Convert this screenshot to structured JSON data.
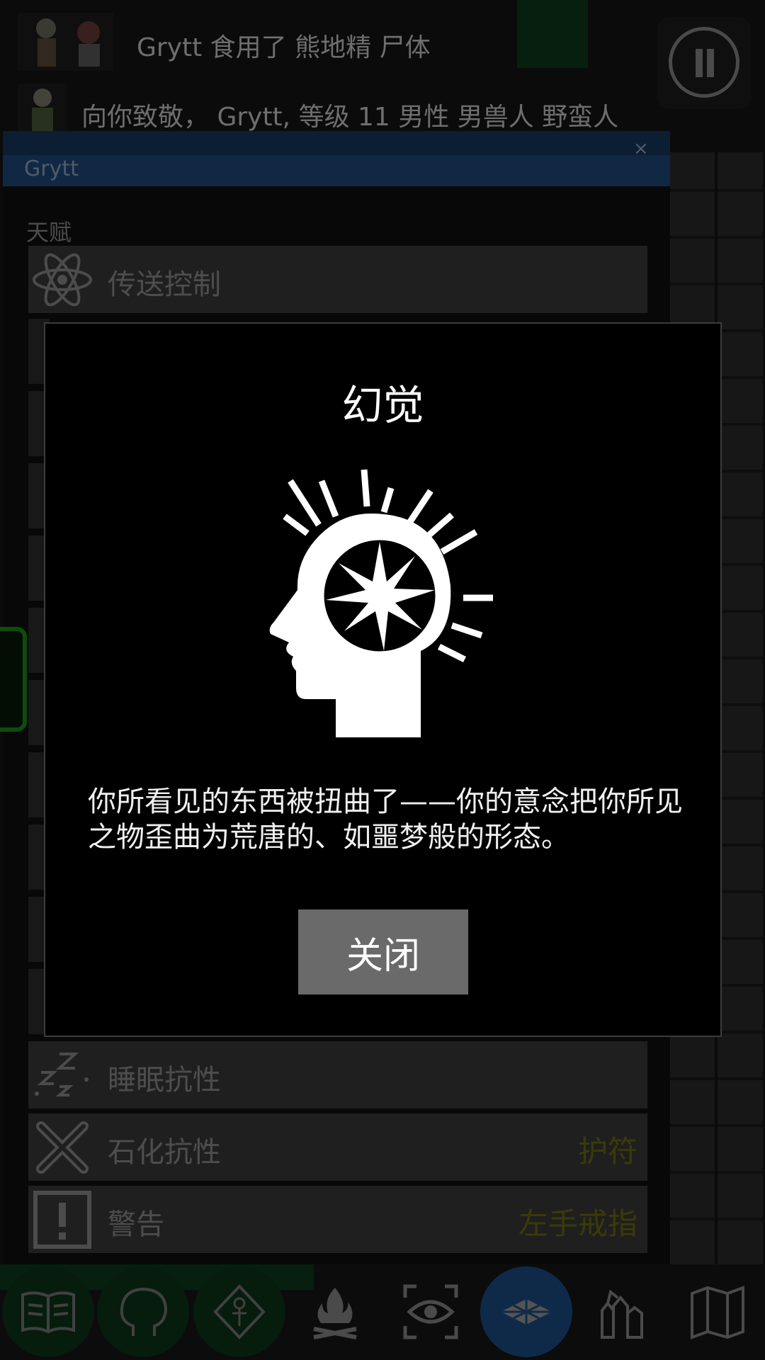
{
  "hud": {
    "message_1": "Grytt 食用了 熊地精 尸体",
    "message_2": "向你致敬， Grytt, 等级 11 男性 男兽人 野蛮人"
  },
  "panel": {
    "title": "Grytt",
    "close_glyph": "×",
    "section_label": "天赋",
    "talents": [
      {
        "name": "传送控制",
        "source": "",
        "icon": "atom-icon"
      },
      {
        "name": "睡眠抗性",
        "source": "",
        "icon": "sleep-zzz-icon"
      },
      {
        "name": "石化抗性",
        "source": "护符",
        "icon": "petrify-x-icon"
      },
      {
        "name": "警告",
        "source": "左手戒指",
        "icon": "warning-icon"
      }
    ]
  },
  "dialog": {
    "title": "幻觉",
    "art_icon": "hallucination-head-icon",
    "body": "你所看见的东西被扭曲了——你的意念把你所见之物歪曲为荒唐的、如噩梦般的形态。",
    "close_label": "关闭"
  },
  "toolbar": {
    "buttons": [
      {
        "icon": "book-icon",
        "highlight": "green"
      },
      {
        "icon": "head-outline-icon",
        "highlight": "green"
      },
      {
        "icon": "ankh-diamond-icon",
        "highlight": "green"
      },
      {
        "icon": "campfire-icon",
        "highlight": "none"
      },
      {
        "icon": "scan-eye-icon",
        "highlight": "none"
      },
      {
        "icon": "floor-tiles-icon",
        "highlight": "blue"
      },
      {
        "icon": "pile-icon",
        "highlight": "none"
      },
      {
        "icon": "map-icon",
        "highlight": "none"
      }
    ]
  },
  "colors": {
    "panel_header": "#1e4a7a",
    "talent_source": "#6b6a10",
    "toolbar_highlight_green": "#0c3418",
    "toolbar_highlight_blue": "#1d4d86"
  }
}
